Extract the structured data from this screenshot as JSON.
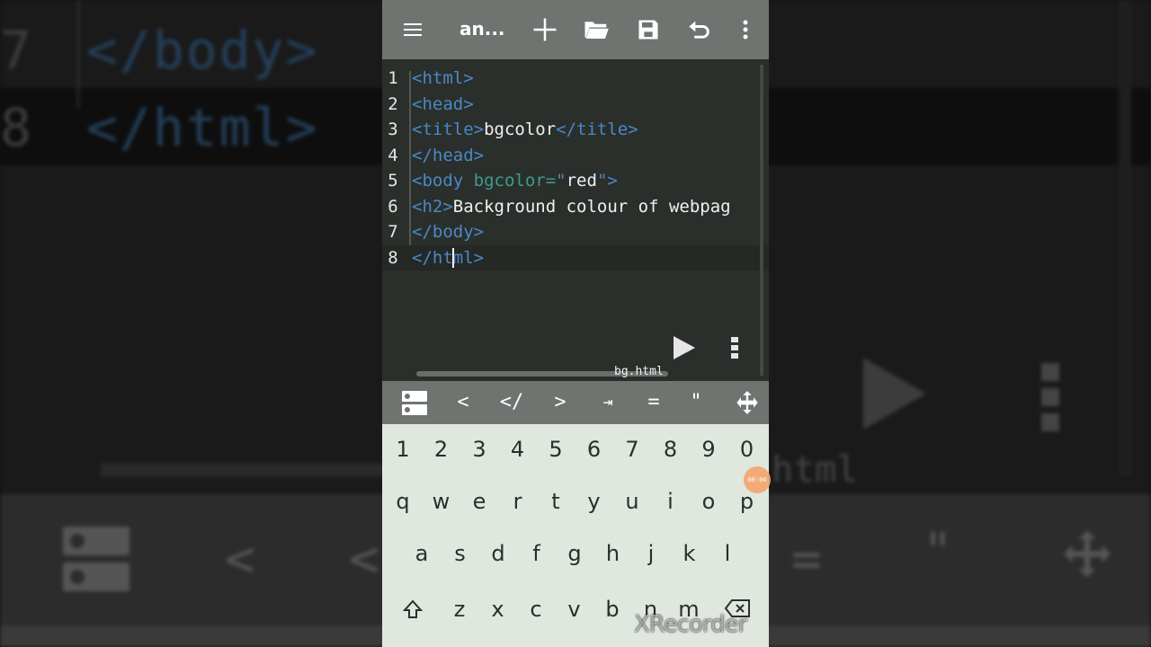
{
  "app": {
    "title": "an...",
    "filename": "bg.html"
  },
  "toolbar": {
    "icons": [
      "menu-icon",
      "add-icon",
      "folder-open-icon",
      "save-icon",
      "undo-icon",
      "more-vert-icon"
    ]
  },
  "editor": {
    "line_numbers": [
      "1",
      "2",
      "3",
      "4",
      "5",
      "6",
      "7",
      "8"
    ],
    "lines": [
      [
        {
          "t": "tag",
          "v": "<html>"
        }
      ],
      [
        {
          "t": "tag",
          "v": "<head>"
        }
      ],
      [
        {
          "t": "tag",
          "v": "<title>"
        },
        {
          "t": "txt",
          "v": "bgcolor"
        },
        {
          "t": "tag",
          "v": "</title>"
        }
      ],
      [
        {
          "t": "tag",
          "v": "</head>"
        }
      ],
      [
        {
          "t": "tag",
          "v": "<body "
        },
        {
          "t": "attr",
          "v": "bgcolor="
        },
        {
          "t": "tag",
          "v": "\""
        },
        {
          "t": "txt",
          "v": "red"
        },
        {
          "t": "tag",
          "v": "\">"
        }
      ],
      [
        {
          "t": "tag",
          "v": "<h2>"
        },
        {
          "t": "txt",
          "v": "Background colour of webpag"
        }
      ],
      [
        {
          "t": "tag",
          "v": "</body>"
        }
      ],
      [
        {
          "t": "tag",
          "v": "</ht"
        },
        {
          "t": "cursor",
          "v": ""
        },
        {
          "t": "tag",
          "v": "ml>"
        }
      ]
    ],
    "active_line": 8
  },
  "symbols": [
    "<",
    "</",
    ">",
    "⇥",
    "=",
    "\""
  ],
  "keyboard": {
    "numbers": [
      "1",
      "2",
      "3",
      "4",
      "5",
      "6",
      "7",
      "8",
      "9",
      "0"
    ],
    "row1": [
      "q",
      "w",
      "e",
      "r",
      "t",
      "y",
      "u",
      "i",
      "o",
      "p"
    ],
    "row2": [
      "a",
      "s",
      "d",
      "f",
      "g",
      "h",
      "j",
      "k",
      "l"
    ],
    "row3": [
      "z",
      "x",
      "c",
      "v",
      "b",
      "n",
      "m"
    ]
  },
  "recorder": {
    "timer": "00:04",
    "watermark": "XRecorder"
  },
  "background_mirror": {
    "line7_num": "7",
    "line7_code": "</body>",
    "line8_num": "8",
    "line8_code": "</html>",
    "ghost_text": "html",
    "symbols": [
      "<",
      "<",
      "=",
      "\""
    ]
  },
  "colors": {
    "toolbar": "#6f7470",
    "editor_bg": "#2b2f2b",
    "tag": "#4a88c7",
    "attr": "#3f9a8c",
    "keyboard_bg": "#dfe7df"
  }
}
